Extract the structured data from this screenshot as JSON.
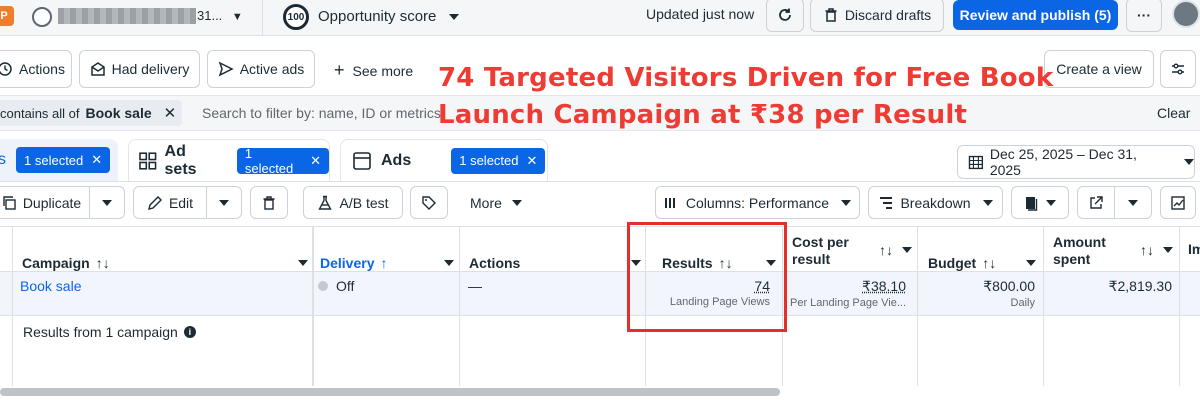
{
  "topbar": {
    "account_initial": "P",
    "account_suffix": "31...",
    "score_value": "100",
    "score_label": "Opportunity score",
    "updated": "Updated just now",
    "discard": "Discard drafts",
    "publish": "Review and publish (5)",
    "more": "···"
  },
  "quickfilters": {
    "actions": "Actions",
    "had_delivery": "Had delivery",
    "active_ads": "Active ads",
    "see_more": "See more",
    "create_view": "Create a view"
  },
  "filter": {
    "chip_prefix": "contains all of",
    "chip_value": "Book sale",
    "search_placeholder": "Search to filter by: name, ID or metrics",
    "clear": "Clear"
  },
  "headline": {
    "line1": "74 Targeted Visitors Driven for Free Book",
    "line2": "Launch Campaign at ₹38 per Result"
  },
  "tabs": {
    "campaigns_pill": "1 selected",
    "adsets_label": "Ad sets",
    "adsets_pill": "1 selected",
    "ads_label": "Ads",
    "ads_pill": "1 selected",
    "date_range": "Dec 25, 2025 – Dec 31, 2025"
  },
  "toolbar": {
    "duplicate": "Duplicate",
    "edit": "Edit",
    "ab_test": "A/B test",
    "more": "More",
    "columns": "Columns: Performance",
    "breakdown": "Breakdown"
  },
  "table": {
    "headers": {
      "campaign": "Campaign",
      "delivery": "Delivery",
      "actions": "Actions",
      "results": "Results",
      "cost_line1": "Cost per",
      "cost_line2": "result",
      "budget": "Budget",
      "amount_line1": "Amount",
      "amount_line2": "spent",
      "extra": "Im"
    },
    "row": {
      "campaign": "Book sale",
      "delivery": "Off",
      "actions": "—",
      "results": "74",
      "results_sub": "Landing Page Views",
      "cost": "₹38.10",
      "cost_sub": "Per Landing Page Vie...",
      "budget": "₹800.00",
      "budget_sub": "Daily",
      "amount": "₹2,819.30"
    },
    "summary": "Results from 1 campaign"
  },
  "colors": {
    "primary": "#0a66e4",
    "headline": "#ee3b33",
    "highlight": "#e5302a"
  }
}
